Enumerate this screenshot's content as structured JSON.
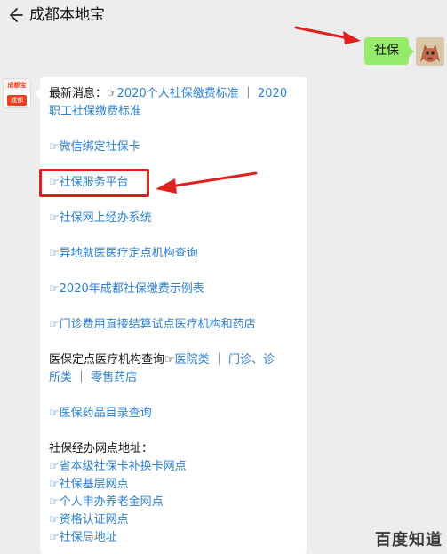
{
  "header": {
    "title": "成都本地宝"
  },
  "sent": {
    "text": "社保"
  },
  "avatar_left": {
    "top": "成都宝",
    "bottom": "成都"
  },
  "reply": {
    "l1": {
      "prefix": "最新消息：☞",
      "link_a1": "2020个人社保缴费标准",
      "sep": " ｜ ",
      "link_a2": "2020"
    },
    "l2": {
      "link": "职工社保缴费标准"
    },
    "l3": {
      "text": "☞微信绑定社保卡"
    },
    "l4": {
      "text": "☞社保服务平台"
    },
    "l5": {
      "text": "☞社保网上经办系统"
    },
    "l6": {
      "text": "☞异地就医医疗定点机构查询"
    },
    "l7": {
      "text": "☞2020年成都社保缴费示例表"
    },
    "l8": {
      "text": "☞门诊费用直接结算试点医疗机构和药店"
    },
    "l9": {
      "prefix": "医保定点医疗机构查询☞",
      "link_a": "医院类",
      "sep": " ｜ ",
      "link_b": "门诊、诊"
    },
    "l10": {
      "link_a": "所类",
      "sep": " ｜ ",
      "link_b": "零售药店"
    },
    "l11": {
      "text": "☞医保药品目录查询"
    },
    "l12": {
      "text": "社保经办网点地址："
    },
    "l13": {
      "text": "☞省本级社保卡补换卡网点"
    },
    "l14": {
      "text": "☞社保基层网点"
    },
    "l15": {
      "text": "☞个人申办养老金网点"
    },
    "l16": {
      "text": "☞资格认证网点"
    },
    "l17": {
      "text": "☞社保局地址"
    }
  },
  "watermark": {
    "text": "百度知道"
  }
}
